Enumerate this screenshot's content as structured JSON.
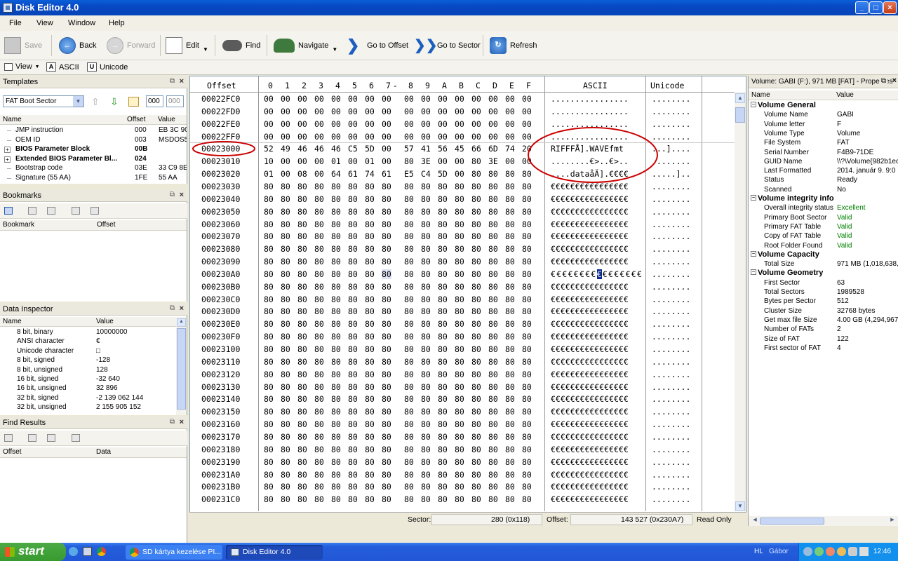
{
  "window": {
    "title": "Disk Editor 4.0",
    "controls": [
      "_",
      "□",
      "×"
    ]
  },
  "menu": [
    "File",
    "View",
    "Window",
    "Help"
  ],
  "toolbar": {
    "save": "Save",
    "back": "Back",
    "forward": "Forward",
    "edit": "Edit",
    "find": "Find",
    "navigate": "Navigate",
    "goto_offset": "Go to Offset",
    "goto_sector": "Go to Sector",
    "refresh": "Refresh"
  },
  "toolbar2": {
    "view": "View",
    "ascii": "ASCII",
    "unicode": "Unicode",
    "ascii_icon": "A",
    "unicode_icon": "U"
  },
  "templates": {
    "title": "Templates",
    "selected": "FAT Boot Sector",
    "field1": "000",
    "field2": "000",
    "cols": [
      "Name",
      "Offset",
      "Value"
    ],
    "rows": [
      {
        "name": "JMP instruction",
        "offset": "000",
        "value": "EB 3C 90",
        "bold": false,
        "exp": false
      },
      {
        "name": "OEM ID",
        "offset": "003",
        "value": "MSDOS5.",
        "bold": false,
        "exp": false
      },
      {
        "name": "BIOS Parameter Block",
        "offset": "00B",
        "value": "",
        "bold": true,
        "exp": true
      },
      {
        "name": "Extended BIOS Parameter Bl...",
        "offset": "024",
        "value": "",
        "bold": true,
        "exp": true
      },
      {
        "name": "Bootstrap code",
        "offset": "03E",
        "value": "33 C9 8E",
        "bold": false,
        "exp": false
      },
      {
        "name": "Signature (55 AA)",
        "offset": "1FE",
        "value": "55 AA",
        "bold": false,
        "exp": false
      }
    ]
  },
  "bookmarks": {
    "title": "Bookmarks",
    "cols": [
      "Bookmark",
      "Offset"
    ]
  },
  "inspector": {
    "title": "Data Inspector",
    "cols": [
      "Name",
      "Value"
    ],
    "rows": [
      [
        "8 bit, binary",
        "10000000"
      ],
      [
        "ANSI character",
        "€"
      ],
      [
        "Unicode character",
        "□"
      ],
      [
        "8 bit, signed",
        "-128"
      ],
      [
        "8 bit, unsigned",
        "128"
      ],
      [
        "16 bit, signed",
        "-32 640"
      ],
      [
        "16 bit, unsigned",
        "32 896"
      ],
      [
        "32 bit, signed",
        "-2 139 062 144"
      ],
      [
        "32 bit, unsigned",
        "2 155 905 152"
      ]
    ]
  },
  "find_results": {
    "title": "Find Results",
    "cols": [
      "Offset",
      "Data"
    ]
  },
  "hex": {
    "headers": {
      "offset": "Offset",
      "ascii": "ASCII",
      "unicode": "Unicode"
    },
    "byte_cols": [
      "0",
      "1",
      "2",
      "3",
      "4",
      "5",
      "6",
      "7",
      "-",
      "8",
      "9",
      "A",
      "B",
      "C",
      "D",
      "E",
      "F"
    ],
    "rows": [
      {
        "off": "00022FC0",
        "bytes": "00 00 00 00 00 00 00 00 00 00 00 00 00 00 00 00",
        "ascii": "................",
        "uni": "........"
      },
      {
        "off": "00022FD0",
        "bytes": "00 00 00 00 00 00 00 00 00 00 00 00 00 00 00 00",
        "ascii": "................",
        "uni": "........"
      },
      {
        "off": "00022FE0",
        "bytes": "00 00 00 00 00 00 00 00 00 00 00 00 00 00 00 00",
        "ascii": "................",
        "uni": "........"
      },
      {
        "off": "00022FF0",
        "bytes": "00 00 00 00 00 00 00 00 00 00 00 00 00 00 00 00",
        "ascii": "................",
        "uni": "........"
      },
      {
        "off": "00023000",
        "bytes": "52 49 46 46 46 C5 5D 00 57 41 56 45 66 6D 74 20",
        "ascii": "RIFFFÅ].WAVEfmt ",
        "uni": "...]...."
      },
      {
        "off": "00023010",
        "bytes": "10 00 00 00 01 00 01 00 80 3E 00 00 80 3E 00 00",
        "ascii": "........€>..€>..",
        "uni": "........"
      },
      {
        "off": "00023020",
        "bytes": "01 00 08 00 64 61 74 61 E5 C4 5D 00 80 80 80 80",
        "ascii": "....dataåÄ].€€€€",
        "uni": ".....]..",
        "uni2": ""
      },
      {
        "off": "00023030",
        "bytes": "80 80 80 80 80 80 80 80 80 80 80 80 80 80 80 80",
        "ascii": "€€€€€€€€€€€€€€€€",
        "uni": "........"
      },
      {
        "off": "00023040",
        "bytes": "80 80 80 80 80 80 80 80 80 80 80 80 80 80 80 80",
        "ascii": "€€€€€€€€€€€€€€€€",
        "uni": "........"
      },
      {
        "off": "00023050",
        "bytes": "80 80 80 80 80 80 80 80 80 80 80 80 80 80 80 80",
        "ascii": "€€€€€€€€€€€€€€€€",
        "uni": "........"
      },
      {
        "off": "00023060",
        "bytes": "80 80 80 80 80 80 80 80 80 80 80 80 80 80 80 80",
        "ascii": "€€€€€€€€€€€€€€€€",
        "uni": "........"
      },
      {
        "off": "00023070",
        "bytes": "80 80 80 80 80 80 80 80 80 80 80 80 80 80 80 80",
        "ascii": "€€€€€€€€€€€€€€€€",
        "uni": "........"
      },
      {
        "off": "00023080",
        "bytes": "80 80 80 80 80 80 80 80 80 80 80 80 80 80 80 80",
        "ascii": "€€€€€€€€€€€€€€€€",
        "uni": "........"
      },
      {
        "off": "00023090",
        "bytes": "80 80 80 80 80 80 80 80 80 80 80 80 80 80 80 80",
        "ascii": "€€€€€€€€€€€€€€€€",
        "uni": "........"
      },
      {
        "off": "000230A0",
        "bytes": "80 80 80 80 80 80 80 80 80 80 80 80 80 80 80 80",
        "ascii": "€€€€€€€€€€€€€€€€",
        "uni": "........",
        "sel": 7
      },
      {
        "off": "000230B0",
        "bytes": "80 80 80 80 80 80 80 80 80 80 80 80 80 80 80 80",
        "ascii": "€€€€€€€€€€€€€€€€",
        "uni": "........"
      },
      {
        "off": "000230C0",
        "bytes": "80 80 80 80 80 80 80 80 80 80 80 80 80 80 80 80",
        "ascii": "€€€€€€€€€€€€€€€€",
        "uni": "........"
      },
      {
        "off": "000230D0",
        "bytes": "80 80 80 80 80 80 80 80 80 80 80 80 80 80 80 80",
        "ascii": "€€€€€€€€€€€€€€€€",
        "uni": "........"
      },
      {
        "off": "000230E0",
        "bytes": "80 80 80 80 80 80 80 80 80 80 80 80 80 80 80 80",
        "ascii": "€€€€€€€€€€€€€€€€",
        "uni": "........"
      },
      {
        "off": "000230F0",
        "bytes": "80 80 80 80 80 80 80 80 80 80 80 80 80 80 80 80",
        "ascii": "€€€€€€€€€€€€€€€€",
        "uni": "........"
      },
      {
        "off": "00023100",
        "bytes": "80 80 80 80 80 80 80 80 80 80 80 80 80 80 80 80",
        "ascii": "€€€€€€€€€€€€€€€€",
        "uni": "........"
      },
      {
        "off": "00023110",
        "bytes": "80 80 80 80 80 80 80 80 80 80 80 80 80 80 80 80",
        "ascii": "€€€€€€€€€€€€€€€€",
        "uni": "........"
      },
      {
        "off": "00023120",
        "bytes": "80 80 80 80 80 80 80 80 80 80 80 80 80 80 80 80",
        "ascii": "€€€€€€€€€€€€€€€€",
        "uni": "........"
      },
      {
        "off": "00023130",
        "bytes": "80 80 80 80 80 80 80 80 80 80 80 80 80 80 80 80",
        "ascii": "€€€€€€€€€€€€€€€€",
        "uni": "........"
      },
      {
        "off": "00023140",
        "bytes": "80 80 80 80 80 80 80 80 80 80 80 80 80 80 80 80",
        "ascii": "€€€€€€€€€€€€€€€€",
        "uni": "........"
      },
      {
        "off": "00023150",
        "bytes": "80 80 80 80 80 80 80 80 80 80 80 80 80 80 80 80",
        "ascii": "€€€€€€€€€€€€€€€€",
        "uni": "........"
      },
      {
        "off": "00023160",
        "bytes": "80 80 80 80 80 80 80 80 80 80 80 80 80 80 80 80",
        "ascii": "€€€€€€€€€€€€€€€€",
        "uni": "........"
      },
      {
        "off": "00023170",
        "bytes": "80 80 80 80 80 80 80 80 80 80 80 80 80 80 80 80",
        "ascii": "€€€€€€€€€€€€€€€€",
        "uni": "........"
      },
      {
        "off": "00023180",
        "bytes": "80 80 80 80 80 80 80 80 80 80 80 80 80 80 80 80",
        "ascii": "€€€€€€€€€€€€€€€€",
        "uni": "........"
      },
      {
        "off": "00023190",
        "bytes": "80 80 80 80 80 80 80 80 80 80 80 80 80 80 80 80",
        "ascii": "€€€€€€€€€€€€€€€€",
        "uni": "........"
      },
      {
        "off": "000231A0",
        "bytes": "80 80 80 80 80 80 80 80 80 80 80 80 80 80 80 80",
        "ascii": "€€€€€€€€€€€€€€€€",
        "uni": "........"
      },
      {
        "off": "000231B0",
        "bytes": "80 80 80 80 80 80 80 80 80 80 80 80 80 80 80 80",
        "ascii": "€€€€€€€€€€€€€€€€",
        "uni": "........"
      },
      {
        "off": "000231C0",
        "bytes": "80 80 80 80 80 80 80 80 80 80 80 80 80 80 80 80",
        "ascii": "€€€€€€€€€€€€€€€€",
        "uni": "........"
      }
    ]
  },
  "status": {
    "sector_label": "Sector:",
    "sector_value": "280 (0x118)",
    "offset_label": "Offset:",
    "offset_value": "143 527 (0x230A7)",
    "mode": "Read Only"
  },
  "properties": {
    "title": "Volume: GABI (F:), 971 MB [FAT] - Properties",
    "cols": [
      "Name",
      "Value"
    ],
    "items": [
      {
        "group": "Volume General"
      },
      {
        "name": "Volume Name",
        "value": "GABI"
      },
      {
        "name": "Volume letter",
        "value": "F"
      },
      {
        "name": "Volume Type",
        "value": "Volume"
      },
      {
        "name": "File System",
        "value": "FAT"
      },
      {
        "name": "Serial Number",
        "value": "F4B9-71DE"
      },
      {
        "name": "GUID Name",
        "value": "\\\\?\\Volume{982b1ec"
      },
      {
        "name": "Last Formatted",
        "value": "2014. január 9. 9:0"
      },
      {
        "name": "Status",
        "value": "Ready"
      },
      {
        "name": "Scanned",
        "value": "No"
      },
      {
        "group": "Volume integrity info"
      },
      {
        "name": "Overall integrity status",
        "value": "Excellent",
        "green": true
      },
      {
        "name": "Primary Boot Sector",
        "value": "Valid",
        "green": true
      },
      {
        "name": "Primary FAT Table",
        "value": "Valid",
        "green": true
      },
      {
        "name": "Copy of FAT Table",
        "value": "Valid",
        "green": true
      },
      {
        "name": "Root Folder Found",
        "value": "Valid",
        "green": true
      },
      {
        "group": "Volume Capacity"
      },
      {
        "name": "Total Size",
        "value": "971 MB (1,018,638,"
      },
      {
        "group": "Volume Geometry"
      },
      {
        "name": "First Sector",
        "value": "63"
      },
      {
        "name": "Total Sectors",
        "value": "1989528"
      },
      {
        "name": "Bytes per Sector",
        "value": "512"
      },
      {
        "name": "Cluster Size",
        "value": "32768 bytes"
      },
      {
        "name": "Get max file Size",
        "value": "4.00 GB (4,294,967,"
      },
      {
        "name": "Number of FATs",
        "value": "2"
      },
      {
        "name": "Size of FAT",
        "value": "122"
      },
      {
        "name": "First sector of FAT",
        "value": "4"
      }
    ]
  },
  "taskbar": {
    "start": "start",
    "items": [
      "SD kártya kezelése PI...",
      "Disk Editor 4.0"
    ],
    "lang": "HL",
    "user": "Gábor",
    "clock": "12:46"
  },
  "colors": {
    "annotation": "#cc0000",
    "titlebar": "#0a5fd8",
    "taskbar": "#245edb",
    "start": "#379a2e"
  }
}
